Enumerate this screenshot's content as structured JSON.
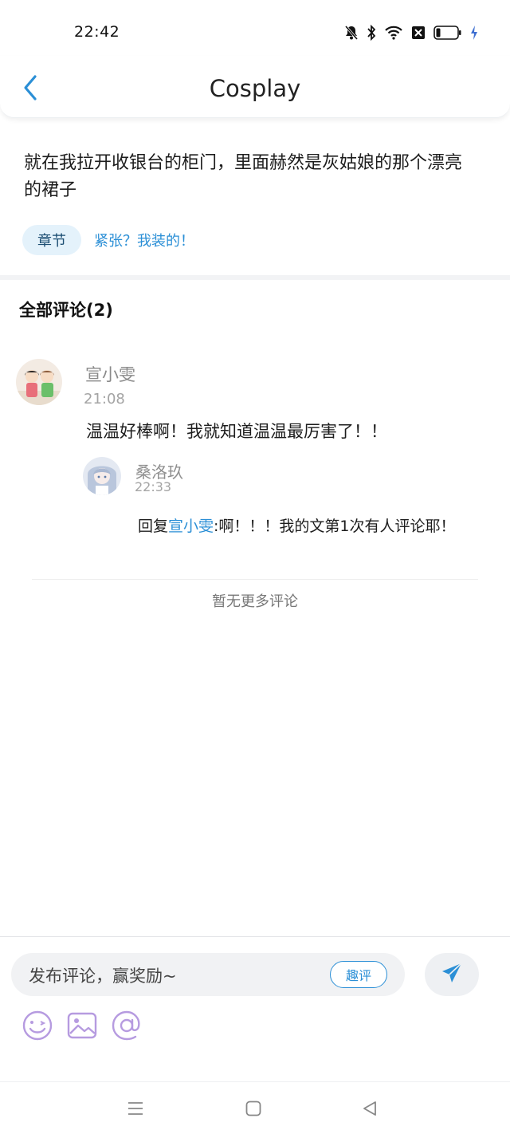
{
  "status_bar": {
    "time": "22:42",
    "icons": [
      "bell-muted-icon",
      "bluetooth-icon",
      "wifi-icon",
      "sim-blocked-icon",
      "battery-icon",
      "charging-icon"
    ]
  },
  "header": {
    "back_icon": "chevron-left-icon",
    "title": "Cosplay"
  },
  "post": {
    "text": "就在我拉开收银台的柜门，里面赫然是灰姑娘的那个漂亮的裙子",
    "chapter_badge": "章节",
    "chapter_title": "紧张？我装的！"
  },
  "comments": {
    "heading": "全部评论(2)",
    "items": [
      {
        "author": "宣小雯",
        "time": "21:08",
        "text": "温温好棒啊！我就知道温温最厉害了！！",
        "replies": [
          {
            "author": "桑洛玖",
            "time": "22:33",
            "prefix": "回复",
            "mention": "宣小雯",
            "text": ":啊！！！我的文第1次有人评论耶！"
          }
        ]
      }
    ],
    "end_text": "暂无更多评论"
  },
  "input_bar": {
    "placeholder": "发布评论，赢奖励~",
    "quick_button": "趣评",
    "send_icon": "send-icon",
    "tools": [
      "emoji-icon",
      "image-icon",
      "mention-at-icon"
    ]
  },
  "nav_bar": {
    "buttons": [
      "menu-icon",
      "home-icon",
      "back-triangle-icon"
    ]
  },
  "colors": {
    "accent": "#2b8fd6",
    "tool_icon": "#b69be0",
    "badge_bg": "#e4f2fb"
  }
}
